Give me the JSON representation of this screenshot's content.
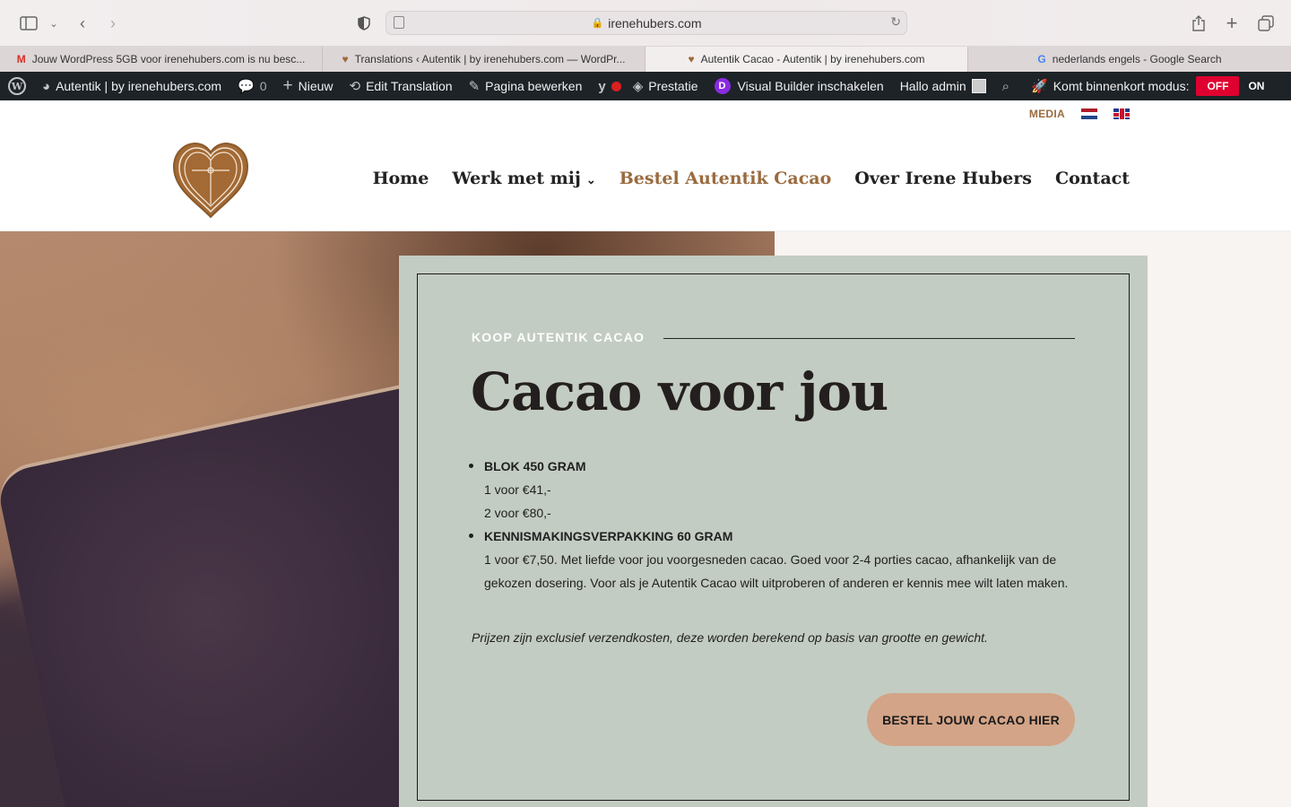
{
  "browser": {
    "url": "irenehubers.com",
    "tabs": [
      {
        "title": "Jouw WordPress 5GB voor irenehubers.com is nu besc...",
        "fav": "M",
        "active": false
      },
      {
        "title": "Translations ‹ Autentik | by irenehubers.com — WordPr...",
        "fav": "♥",
        "active": false
      },
      {
        "title": "Autentik Cacao - Autentik | by irenehubers.com",
        "fav": "♥",
        "active": true
      },
      {
        "title": "nederlands engels - Google Search",
        "fav": "G",
        "active": false
      }
    ]
  },
  "adminbar": {
    "site": "Autentik | by irenehubers.com",
    "comments": "0",
    "new": "Nieuw",
    "edit_translation": "Edit Translation",
    "edit_page": "Pagina bewerken",
    "performance": "Prestatie",
    "visual_builder": "Visual Builder inschakelen",
    "greeting": "Hallo admin",
    "coming_soon": "Komt binnenkort modus:",
    "off": "OFF",
    "on": "ON"
  },
  "header": {
    "media": "MEDIA",
    "nav": [
      {
        "label": "Home",
        "active": false
      },
      {
        "label": "Werk met mij",
        "active": false,
        "dropdown": true
      },
      {
        "label": "Bestel Autentik Cacao",
        "active": true
      },
      {
        "label": "Over Irene Hubers",
        "active": false
      },
      {
        "label": "Contact",
        "active": false
      }
    ]
  },
  "card": {
    "eyebrow": "KOOP AUTENTIK CACAO",
    "heading": "Cacao voor jou",
    "items": [
      {
        "title": "BLOK 450 GRAM",
        "lines": [
          "1 voor €41,-",
          "2 voor €80,-"
        ]
      },
      {
        "title": "KENNISMAKINGSVERPAKKING 60 GRAM",
        "lines": [
          "1 voor €7,50. Met liefde voor jou voorgesneden cacao. Goed voor 2-4 porties cacao, afhankelijk van de gekozen dosering. Voor als je Autentik Cacao wilt uitproberen of anderen er kennis mee wilt laten maken."
        ]
      }
    ],
    "note": "Prijzen zijn exclusief verzendkosten, deze worden berekend op basis van grootte en gewicht.",
    "cta": "BESTEL JOUW CACAO HIER"
  },
  "colors": {
    "accent": "#9a6b3f",
    "card_bg": "#c3ccc2",
    "cta_bg": "#d3a487",
    "adminbar_bg": "#1d2327"
  }
}
